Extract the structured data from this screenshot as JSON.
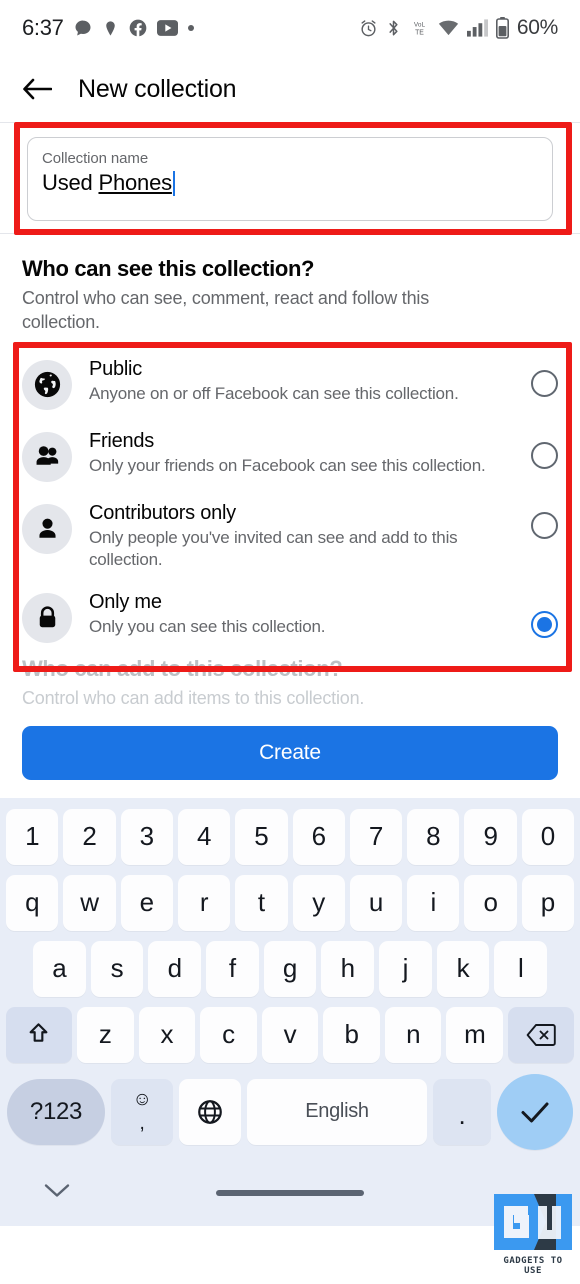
{
  "statusbar": {
    "time": "6:37",
    "left_icons": [
      "chat-bubble-icon",
      "location-pin-icon",
      "facebook-icon",
      "youtube-icon",
      "dot-icon"
    ],
    "right_icons": [
      "alarm-icon",
      "bluetooth-icon",
      "volte-icon",
      "wifi-icon",
      "signal-icon",
      "battery-icon"
    ],
    "battery": "60%"
  },
  "appbar": {
    "back_icon": "arrow-left-icon",
    "title": "New collection"
  },
  "name_field": {
    "label": "Collection name",
    "value_plain": "Used ",
    "value_spell": "Phones"
  },
  "visibility": {
    "title": "Who can see this collection?",
    "subtitle": "Control who can see, comment, react and follow this collection.",
    "options": [
      {
        "icon": "globe-icon",
        "title": "Public",
        "desc": "Anyone on or off Facebook can see this collection.",
        "selected": false
      },
      {
        "icon": "friends-icon",
        "title": "Friends",
        "desc": "Only your friends on Facebook can see this collection.",
        "selected": false
      },
      {
        "icon": "person-icon",
        "title": "Contributors only",
        "desc": "Only people you've invited can see and add to this collection.",
        "selected": false
      },
      {
        "icon": "lock-icon",
        "title": "Only me",
        "desc": "Only you can see this collection.",
        "selected": true
      }
    ]
  },
  "add_section": {
    "title": "Who can add to this collection?",
    "subtitle": "Control who can add items to this collection."
  },
  "cta": {
    "label": "Create"
  },
  "keyboard": {
    "row1": [
      "1",
      "2",
      "3",
      "4",
      "5",
      "6",
      "7",
      "8",
      "9",
      "0"
    ],
    "row2": [
      "q",
      "w",
      "e",
      "r",
      "t",
      "y",
      "u",
      "i",
      "o",
      "p"
    ],
    "row3": [
      "a",
      "s",
      "d",
      "f",
      "g",
      "h",
      "j",
      "k",
      "l"
    ],
    "row4": [
      "z",
      "x",
      "c",
      "v",
      "b",
      "n",
      "m"
    ],
    "shift_icon": "shift-arrow-icon",
    "backspace_icon": "backspace-icon",
    "symbols_label": "?123",
    "emoji_icon": "emoji-smiley-icon",
    "comma_label": ",",
    "language_icon": "globe-language-icon",
    "space_label": "English",
    "period_label": ".",
    "enter_icon": "check-icon"
  },
  "navbar": {
    "hide_keyboard_icon": "chevron-down-icon",
    "home_pill": "home-gesture-pill"
  },
  "watermark": {
    "text": "GADGETS TO USE"
  },
  "colors": {
    "accent_blue": "#1b74e4",
    "annotation_red": "#ee1b18",
    "icon_circle": "#e4e6eb",
    "keyboard_bg": "#e8edf7",
    "secondary_text": "#65676b"
  }
}
